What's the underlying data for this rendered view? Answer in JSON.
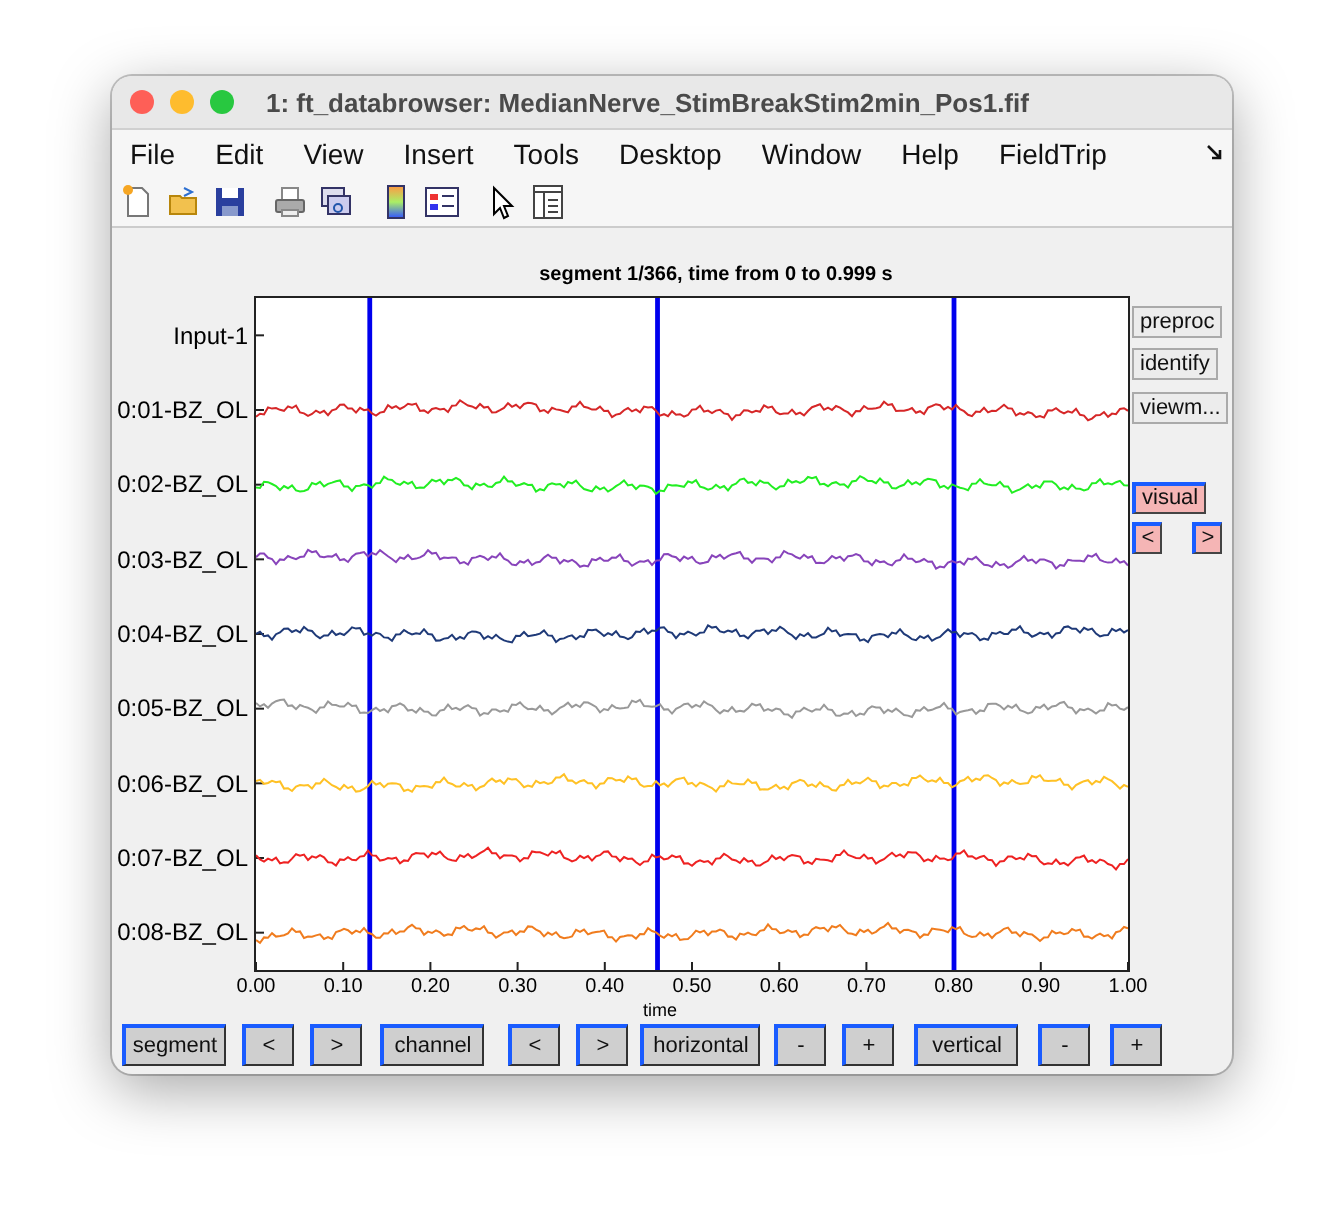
{
  "window": {
    "title": "1: ft_databrowser: MedianNerve_StimBreakStim2min_Pos1.fif"
  },
  "menu": [
    "File",
    "Edit",
    "View",
    "Insert",
    "Tools",
    "Desktop",
    "Window",
    "Help",
    "FieldTrip"
  ],
  "toolbar": [
    {
      "kind": "new"
    },
    {
      "kind": "open"
    },
    {
      "kind": "save"
    },
    {
      "kind": "print"
    },
    {
      "kind": "link"
    },
    {
      "kind": "colorbar"
    },
    {
      "kind": "legend"
    },
    {
      "kind": "pointer"
    },
    {
      "kind": "panel"
    }
  ],
  "plot": {
    "title": "segment 1/366, time from 0 to 0.999 s",
    "xlabel": "time",
    "xticks": [
      "0.00",
      "0.10",
      "0.20",
      "0.30",
      "0.40",
      "0.50",
      "0.60",
      "0.70",
      "0.80",
      "0.90",
      "1.00"
    ],
    "events": [
      {
        "level": 0.13
      },
      {
        "level": 0.46
      },
      {
        "level": 0.8
      }
    ],
    "channels": [
      {
        "name": "Input-1"
      },
      {
        "name": "0:01-BZ_OL",
        "color": "#d62728"
      },
      {
        "name": "0:02-BZ_OL",
        "color": "#22ee22"
      },
      {
        "name": "0:03-BZ_OL",
        "color": "#8844bb"
      },
      {
        "name": "0:04-BZ_OL",
        "color": "#1f3a78"
      },
      {
        "name": "0:05-BZ_OL",
        "color": "#999999"
      },
      {
        "name": "0:06-BZ_OL",
        "color": "#ffc125"
      },
      {
        "name": "0:07-BZ_OL",
        "color": "#ee2222"
      },
      {
        "name": "0:08-BZ_OL",
        "color": "#f07c1e"
      }
    ]
  },
  "side_buttons": [
    {
      "label": "preproc",
      "kind": "plain"
    },
    {
      "label": "identify",
      "kind": "plain"
    },
    {
      "label": "viewm...",
      "kind": "plain"
    },
    {
      "label": "visual",
      "kind": "pink"
    },
    {
      "label": "<",
      "kind": "pinksmall"
    },
    {
      "label": ">",
      "kind": "pinksmall"
    }
  ],
  "bottom_buttons": [
    "segment",
    "<",
    ">",
    "channel",
    "<",
    ">",
    "horizontal",
    "-",
    "+",
    "vertical",
    "-",
    "+"
  ]
}
